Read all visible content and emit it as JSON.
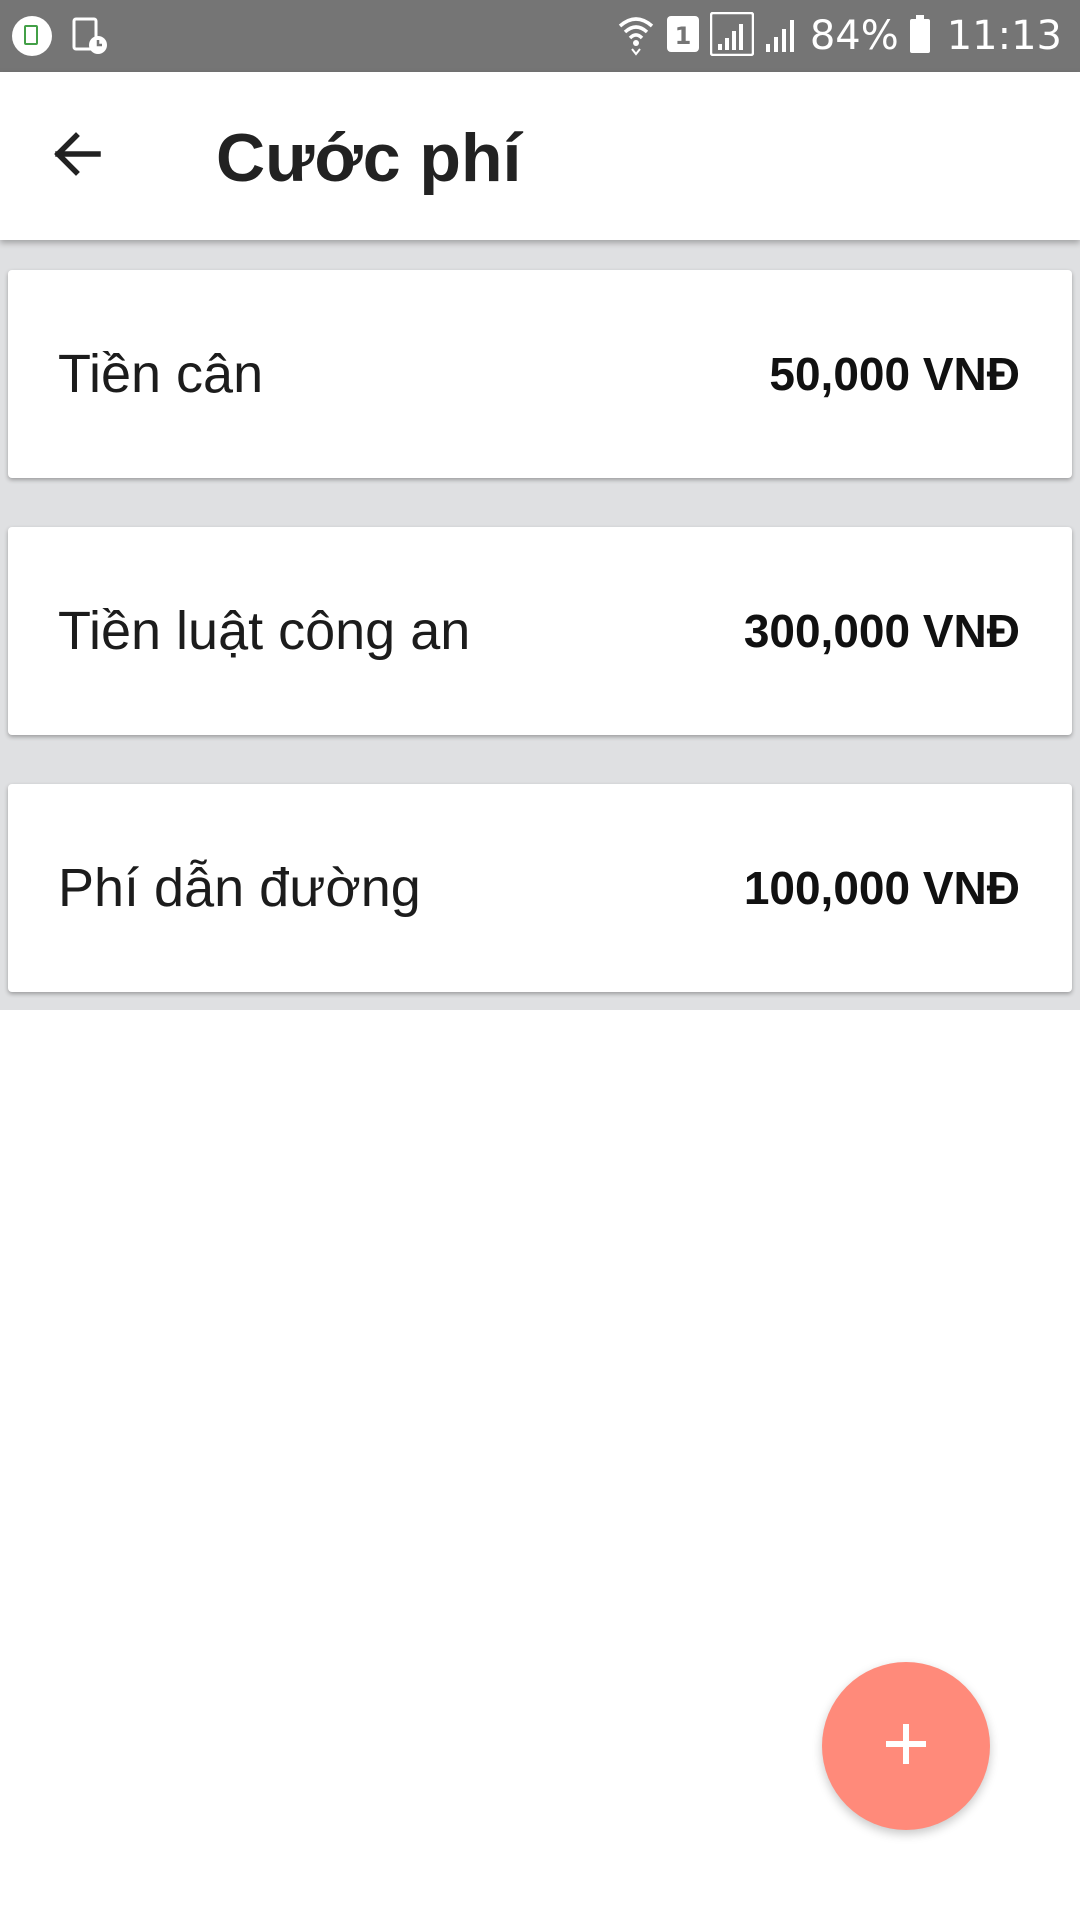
{
  "status_bar": {
    "battery_percent": "84%",
    "time": "11:13",
    "sim_slot": "1",
    "icons": [
      "app-notification-icon",
      "screenshot-icon",
      "wifi-icon",
      "sim-1-icon",
      "signal-icon",
      "signal-icon",
      "battery-icon"
    ]
  },
  "app_bar": {
    "title": "Cước phí",
    "back_icon": "arrow-back-icon"
  },
  "fees": [
    {
      "name": "Tiền cân",
      "amount": "50,000 VNĐ"
    },
    {
      "name": "Tiền luật công an",
      "amount": "300,000 VNĐ"
    },
    {
      "name": "Phí dẫn đường",
      "amount": "100,000 VNĐ"
    }
  ],
  "fab": {
    "icon": "plus-icon",
    "color": "#ff8a7a"
  },
  "colors": {
    "status_bar": "#757575",
    "list_background": "#dfe0e2",
    "accent": "#ff8a7a"
  }
}
